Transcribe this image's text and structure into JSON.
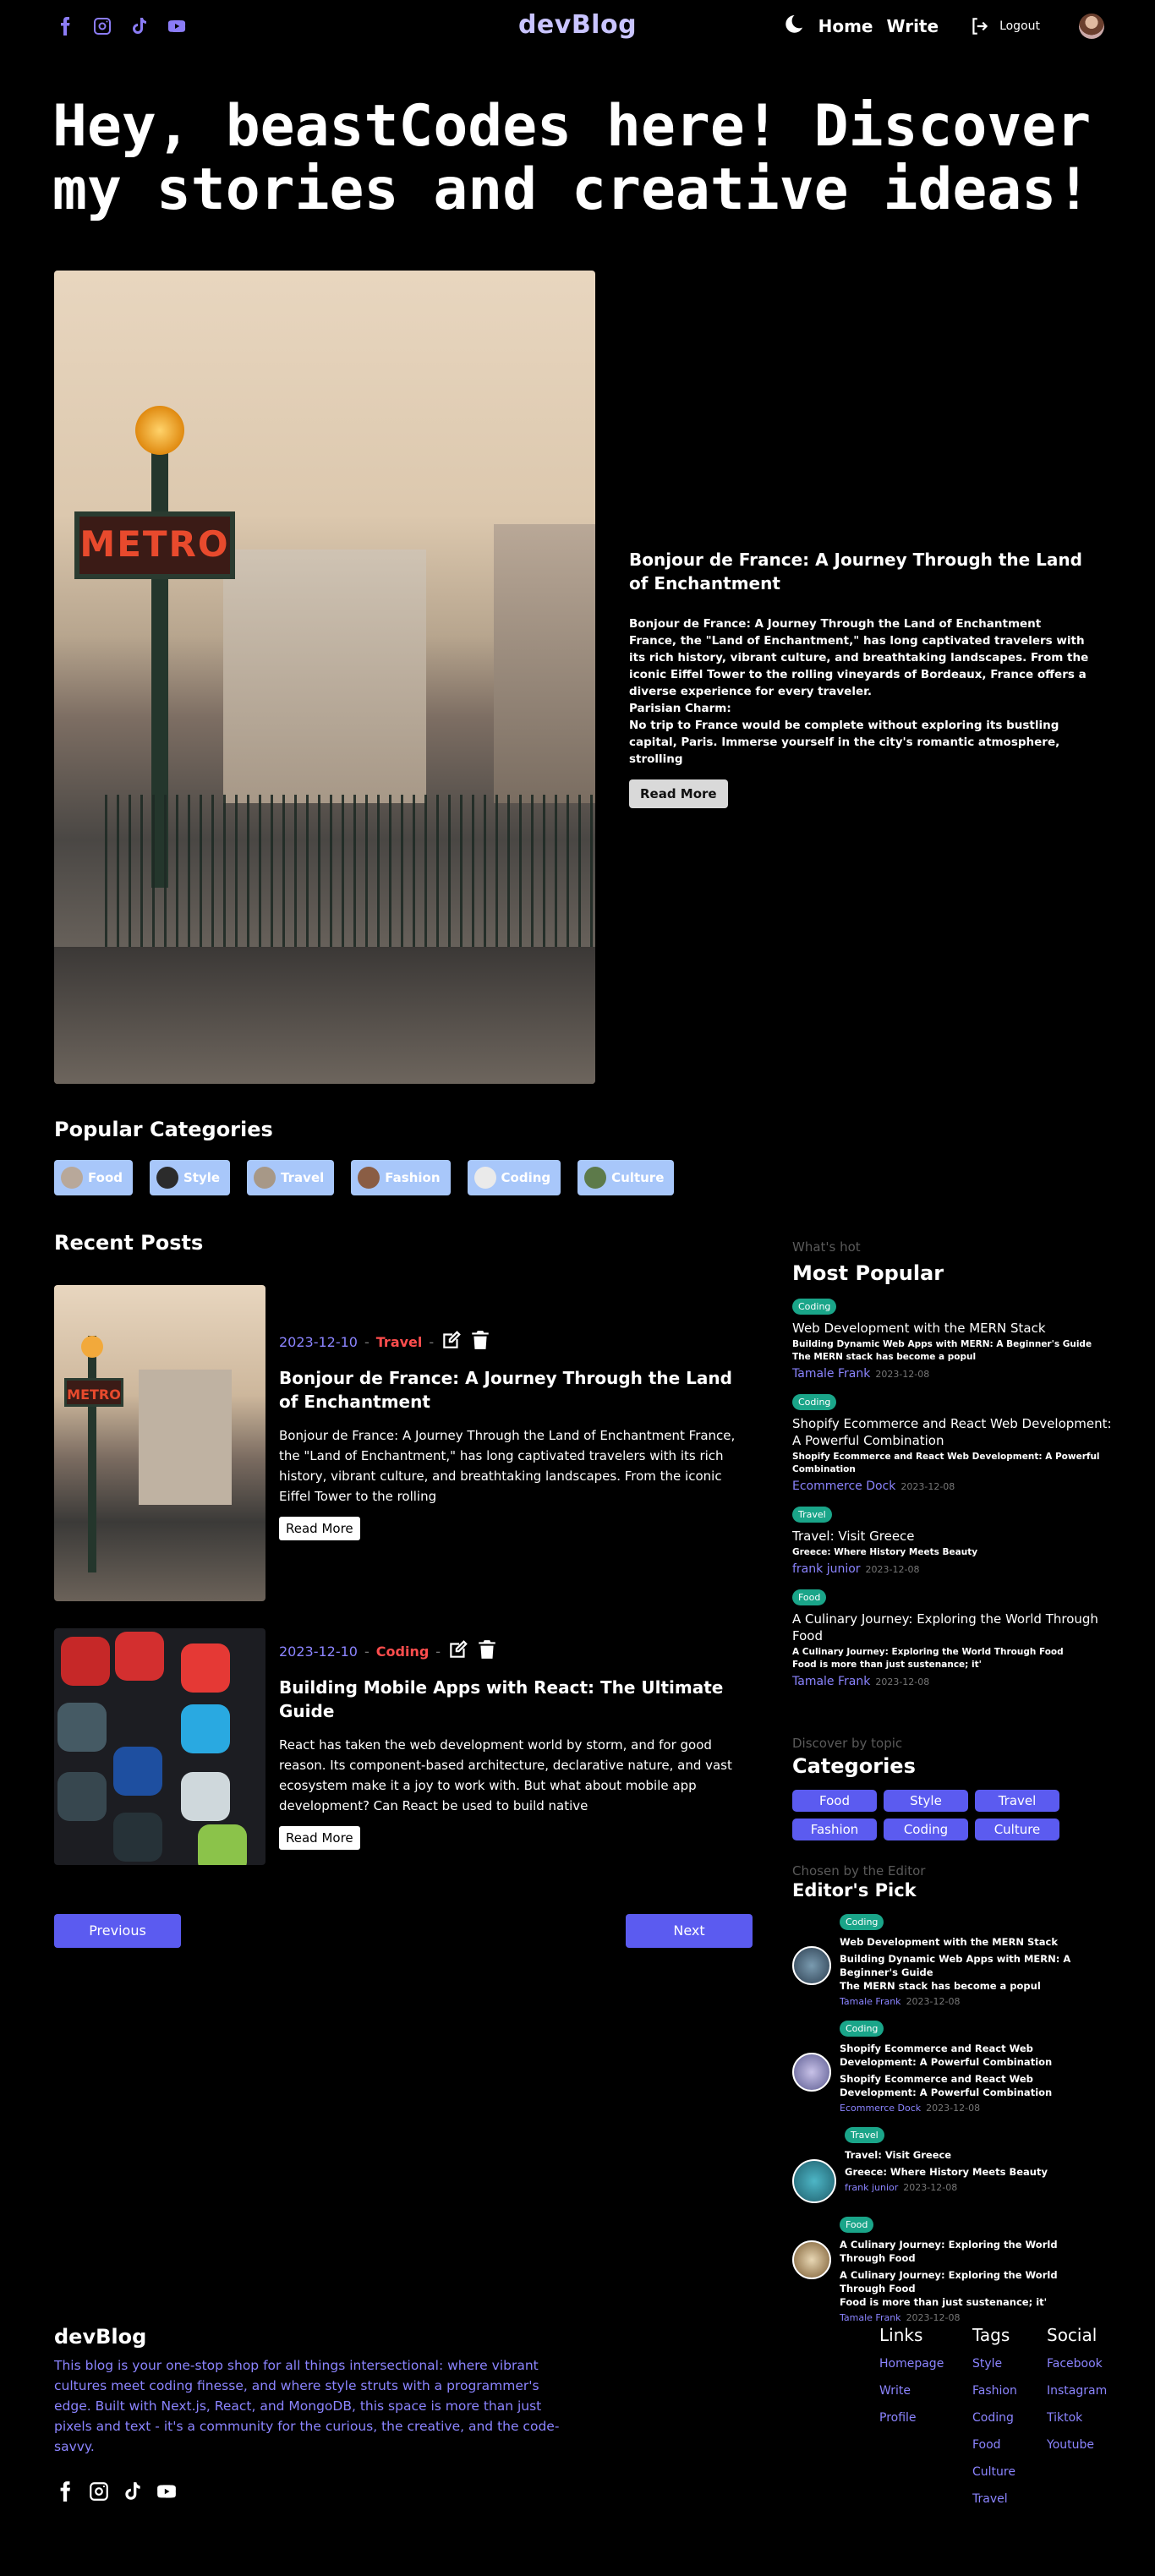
{
  "navbar": {
    "social": [
      "facebook-icon",
      "instagram-icon",
      "tiktok-icon",
      "youtube-icon"
    ],
    "brand": "devBlog",
    "links": {
      "home": "Home",
      "write": "Write",
      "logout": "Logout"
    }
  },
  "hero": {
    "bold": "Hey, beastCodes here!",
    "rest": " Discover my stories and creative ideas!"
  },
  "featured": {
    "image_sign": "METRO",
    "title": "Bonjour de France: A Journey Through the Land of Enchantment",
    "description": "Bonjour de France: A Journey Through the Land of Enchantment\nFrance, the \"Land of Enchantment,\" has long captivated travelers with its rich history, vibrant culture, and breathtaking landscapes. From the iconic Eiffel Tower to the rolling vineyards of Bordeaux, France offers a diverse experience for every traveler.\nParisian Charm:\nNo trip to France would be complete without exploring its bustling capital, Paris. Immerse yourself in the city's romantic atmosphere, strolling",
    "button": "Read More"
  },
  "popular_categories": {
    "heading": "Popular Categories",
    "items": [
      "Food",
      "Style",
      "Travel",
      "Fashion",
      "Coding",
      "Culture"
    ]
  },
  "recent": {
    "heading": "Recent Posts",
    "posts": [
      {
        "date": "2023-12-10",
        "sep": "-",
        "category": "Travel",
        "title": "Bonjour de France: A Journey Through the Land of Enchantment",
        "excerpt": "Bonjour de France: A Journey Through the Land of Enchantment France, the \"Land of Enchantment,\" has long captivated travelers with its rich history, vibrant culture, and breathtaking landscapes. From the iconic Eiffel Tower to the rolling",
        "button": "Read More"
      },
      {
        "date": "2023-12-10",
        "sep": "-",
        "category": "Coding",
        "title": "Building Mobile Apps with React: The Ultimate Guide",
        "excerpt": "React has taken the web development world by storm, and for good reason. Its component-based architecture, declarative nature, and vast ecosystem make it a joy to work with. But what about mobile app development? Can React be used to build native",
        "button": "Read More"
      }
    ],
    "prev": "Previous",
    "next": "Next"
  },
  "sidebar": {
    "popular": {
      "sub": "What's hot",
      "heading": "Most Popular",
      "items": [
        {
          "tag": "Coding",
          "tag_color": "#1aa589",
          "title": "Web Development with the MERN Stack",
          "desc": "Building Dynamic Web Apps with MERN: A Beginner's Guide\nThe MERN stack has become a popul",
          "author": "Tamale Frank",
          "date": "2023-12-08"
        },
        {
          "tag": "Coding",
          "tag_color": "#1aa589",
          "title": "Shopify Ecommerce and React Web Development: A Powerful Combination",
          "desc": "Shopify Ecommerce and React Web Development: A Powerful Combination",
          "author": "Ecommerce Dock",
          "date": "2023-12-08"
        },
        {
          "tag": "Travel",
          "tag_color": "#1aa589",
          "title": "Travel: Visit Greece",
          "desc": "Greece: Where History Meets Beauty",
          "author": "frank junior",
          "date": "2023-12-08"
        },
        {
          "tag": "Food",
          "tag_color": "#1aa589",
          "title": "A Culinary Journey: Exploring the World Through Food",
          "desc": "A Culinary Journey: Exploring the World Through Food\nFood is more than just sustenance; it'",
          "author": "Tamale Frank",
          "date": "2023-12-08"
        }
      ]
    },
    "topics": {
      "sub": "Discover by topic",
      "heading": "Categories",
      "items": [
        "Food",
        "Style",
        "Travel",
        "Fashion",
        "Coding",
        "Culture"
      ]
    },
    "editor": {
      "sub": "Chosen by the Editor",
      "heading": "Editor's Pick",
      "items": [
        {
          "tag": "Coding",
          "title": "Web Development with the MERN Stack",
          "desc": "Building Dynamic Web Apps with MERN: A Beginner's Guide\nThe MERN stack has become a popul",
          "author": "Tamale Frank",
          "date": "2023-12-08"
        },
        {
          "tag": "Coding",
          "title": "Shopify Ecommerce and React Web Development: A Powerful Combination",
          "desc": "Shopify Ecommerce and React Web Development: A Powerful Combination",
          "author": "Ecommerce Dock",
          "date": "2023-12-08"
        },
        {
          "tag": "Travel",
          "title": "Travel: Visit Greece",
          "desc": "Greece: Where History Meets Beauty",
          "author": "frank junior",
          "date": "2023-12-08"
        },
        {
          "tag": "Food",
          "title": "A Culinary Journey: Exploring the World Through Food",
          "desc": "A Culinary Journey: Exploring the World Through Food\nFood is more than just sustenance; it'",
          "author": "Tamale Frank",
          "date": "2023-12-08"
        }
      ]
    }
  },
  "footer": {
    "brand": "devBlog",
    "description": "This blog is your one-stop shop for all things intersectional: where vibrant cultures meet coding finesse, and where style struts with a programmer's edge. Built with Next.js, React, and MongoDB, this space is more than just pixels and text - it's a community for the curious, the creative, and the code-savvy.",
    "columns": [
      {
        "heading": "Links",
        "items": [
          "Homepage",
          "Write",
          "Profile"
        ]
      },
      {
        "heading": "Tags",
        "items": [
          "Style",
          "Fashion",
          "Coding",
          "Food",
          "Culture",
          "Travel"
        ]
      },
      {
        "heading": "Social",
        "items": [
          "Facebook",
          "Instagram",
          "Tiktok",
          "Youtube"
        ]
      }
    ]
  },
  "colors": {
    "accent": "#5b5bf0",
    "link": "#8b84ff",
    "tag": "#1aa589",
    "category_chip": "#a8c7fa",
    "post_category": "#ff4d4d"
  }
}
